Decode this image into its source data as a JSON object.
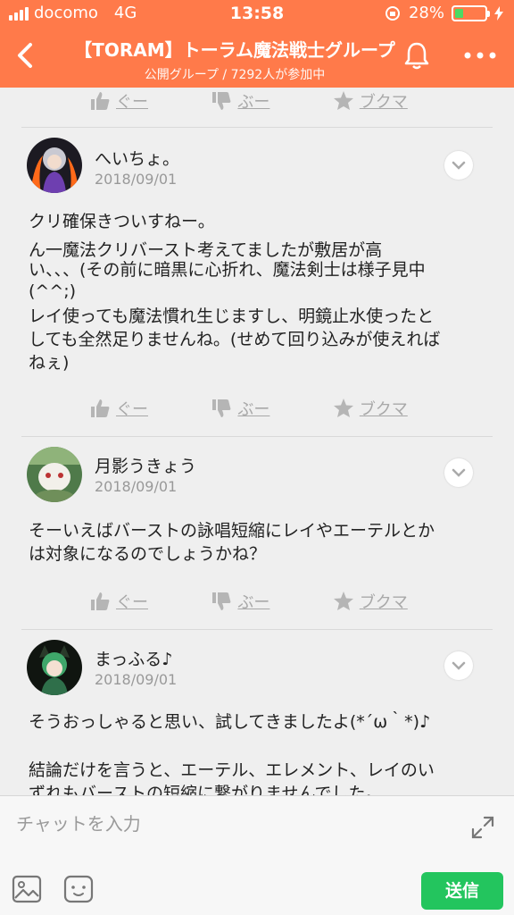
{
  "status_bar": {
    "carrier": "docomo",
    "network": "4G",
    "time": "13:58",
    "battery_percent_label": "28%",
    "battery_level": 0.28,
    "battery_color": "#4cd964"
  },
  "header": {
    "background": "#ff7a4a",
    "title": "【TORAM】トーラム魔法戦士グループ",
    "subtitle": "公開グループ / 7292人が参加中",
    "back_icon": "chevron-left-icon",
    "bell_icon": "bell-icon",
    "more_icon": "more-dots-icon"
  },
  "reactions": {
    "good": "ぐー",
    "bad": "ぶー",
    "bookmark": "ブクマ"
  },
  "posts": [
    {
      "author": "へいちょ。",
      "date": "2018/09/01",
      "lines": [
        "クリ確保きついすねー。",
        "ん一魔法クリバースト考えてましたが敷居が高",
        "い、、、(その前に暗黒に心折れ、魔法剣士は様子見中",
        "(^^;)",
        "レイ使っても魔法慣れ生じますし、明鏡止水使ったと",
        "しても全然足りませんね。(せめて回り込みが使えれば",
        "ねぇ)"
      ]
    },
    {
      "author": "月影うきょう",
      "date": "2018/09/01",
      "lines": [
        "そーいえばバーストの詠唱短縮にレイやエーテルとか",
        "は対象になるのでしょうかね？"
      ]
    },
    {
      "author": "まっふる♪",
      "date": "2018/09/01",
      "lines": [
        "そうおっしゃると思い、試してきましたよ(*´ω｀*)♪",
        "",
        "結論だけを言うと、エーテル、エレメント、レイのい",
        "ずれもバーストの短縮に繋がりませんでした。"
      ]
    }
  ],
  "composer": {
    "placeholder": "チャットを入力",
    "value": "",
    "send_label": "送信",
    "send_color": "#23c55e"
  }
}
